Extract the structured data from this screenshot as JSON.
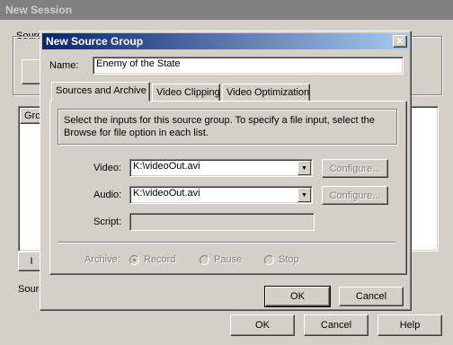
{
  "outer_window": {
    "title": "New Session",
    "section_label_top": "Source",
    "list_header": "Gro",
    "section_label_bottom": "Sourc",
    "buttons": {
      "ok": "OK",
      "cancel": "Cancel",
      "help": "Help",
      "left_button_fragment": "I"
    }
  },
  "dialog": {
    "title": "New Source Group",
    "close_glyph": "✕",
    "name_label": "Name:",
    "name_value": "Enemy of the State",
    "tabs": [
      {
        "label": "Sources and Archive",
        "active": true
      },
      {
        "label": "Video Clipping",
        "active": false
      },
      {
        "label": "Video Optimization",
        "active": false
      }
    ],
    "instructions": "Select the inputs for this source group. To specify a file input, select the Browse for file option in each list.",
    "video_label": "Video:",
    "video_value": "K:\\videoOut.avi",
    "audio_label": "Audio:",
    "audio_value": "K:\\videoOut.avi",
    "script_label": "Script:",
    "configure_label": "Configure...",
    "archive_label": "Archive:",
    "archive_options": [
      {
        "label": "Record",
        "selected": true
      },
      {
        "label": "Pause",
        "selected": false
      },
      {
        "label": "Stop",
        "selected": false
      }
    ],
    "ok_label": "OK",
    "cancel_label": "Cancel"
  }
}
